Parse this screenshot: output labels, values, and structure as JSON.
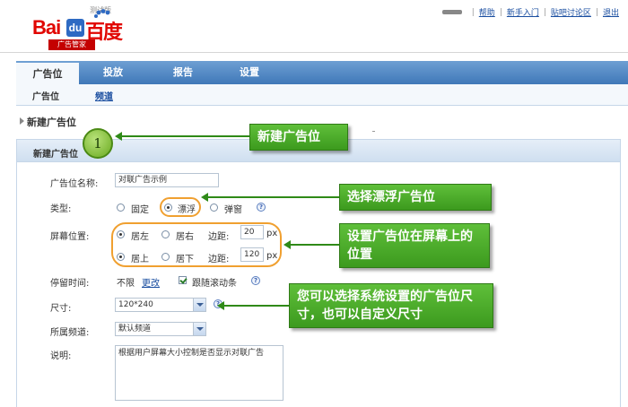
{
  "header": {
    "logo_text_latin": "Bai",
    "logo_text_du": "du",
    "logo_text_cn": "百度",
    "logo_sub": "广告管家",
    "beta": "测试版",
    "links": [
      "帮助",
      "新手入门",
      "贴吧讨论区",
      "退出"
    ]
  },
  "nav": {
    "tabs": [
      "广告位",
      "投放",
      "报告",
      "设置"
    ],
    "sub_tabs": [
      "广告位",
      "频道"
    ]
  },
  "section_title": "新建广告位",
  "panel_title": "新建广告位",
  "form": {
    "name_label": "广告位名称:",
    "name_value": "对联广告示例",
    "type_label": "类型:",
    "type_options": [
      "固定",
      "漂浮",
      "弹窗"
    ],
    "position_label": "屏幕位置:",
    "h_options": [
      "居左",
      "居右"
    ],
    "v_options": [
      "居上",
      "居下"
    ],
    "margin_label": "边距:",
    "margin_h_value": "20",
    "margin_v_value": "120",
    "unit": "px",
    "stay_label": "停留时间:",
    "stay_value": "不限",
    "change_link": "更改",
    "follow_scroll": "跟随滚动条",
    "size_label": "尺寸:",
    "size_value": "120*240",
    "channel_label": "所属频道:",
    "channel_value": "默认频道",
    "desc_label": "说明:",
    "desc_value": "根据用户屏幕大小控制是否显示对联广告",
    "help_glyph": "?"
  },
  "annotations": {
    "step_number": "1",
    "callout_1": "新建广告位",
    "callout_2": "选择漂浮广告位",
    "callout_3": "设置广告位在屏幕上的位置",
    "callout_4": "您可以选择系统设置的广告位尺寸，也可以自定义尺寸"
  },
  "colors": {
    "nav_blue": "#3f78b8",
    "callout_green": "#4caf28",
    "highlight_orange": "#f0a030",
    "brand_red": "#e10601"
  }
}
